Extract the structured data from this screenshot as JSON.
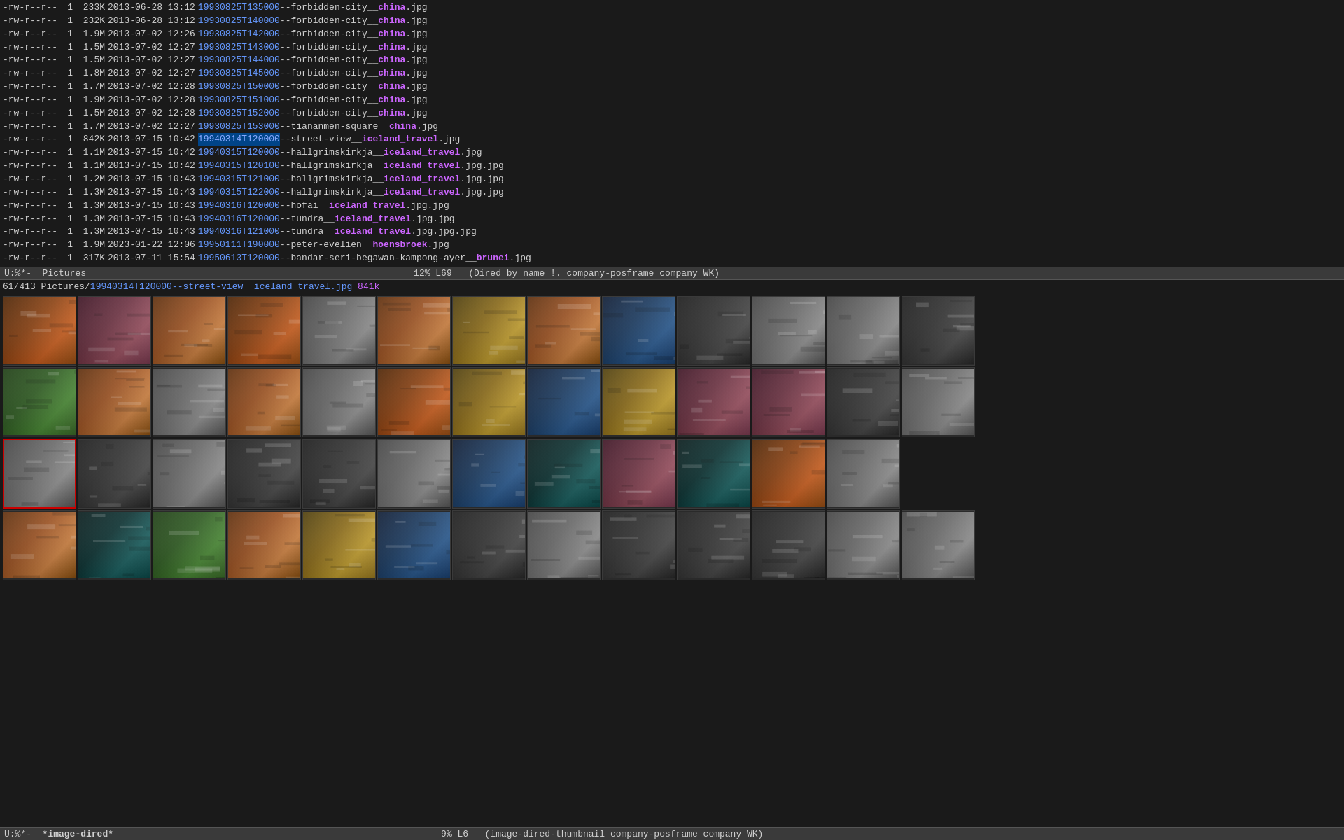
{
  "terminal": {
    "files": [
      {
        "perm": "-rw-r--r--",
        "links": "1",
        "size": "233K",
        "date": "2013-06-28",
        "time": "13:12",
        "link": "19930825T135000",
        "sep": "--",
        "desc": "forbidden-city__",
        "tag": "china",
        "ext": ".jpg",
        "tag_color": "purple"
      },
      {
        "perm": "-rw-r--r--",
        "links": "1",
        "size": "232K",
        "date": "2013-06-28",
        "time": "13:12",
        "link": "19930825T140000",
        "sep": "--",
        "desc": "forbidden-city__",
        "tag": "china",
        "ext": ".jpg",
        "tag_color": "purple"
      },
      {
        "perm": "-rw-r--r--",
        "links": "1",
        "size": "1.9M",
        "date": "2013-07-02",
        "time": "12:26",
        "link": "19930825T142000",
        "sep": "--",
        "desc": "forbidden-city__",
        "tag": "china",
        "ext": ".jpg",
        "tag_color": "purple"
      },
      {
        "perm": "-rw-r--r--",
        "links": "1",
        "size": "1.5M",
        "date": "2013-07-02",
        "time": "12:27",
        "link": "19930825T143000",
        "sep": "--",
        "desc": "forbidden-city__",
        "tag": "china",
        "ext": ".jpg",
        "tag_color": "purple"
      },
      {
        "perm": "-rw-r--r--",
        "links": "1",
        "size": "1.5M",
        "date": "2013-07-02",
        "time": "12:27",
        "link": "19930825T144000",
        "sep": "--",
        "desc": "forbidden-city__",
        "tag": "china",
        "ext": ".jpg",
        "tag_color": "purple"
      },
      {
        "perm": "-rw-r--r--",
        "links": "1",
        "size": "1.8M",
        "date": "2013-07-02",
        "time": "12:27",
        "link": "19930825T145000",
        "sep": "--",
        "desc": "forbidden-city__",
        "tag": "china",
        "ext": ".jpg",
        "tag_color": "purple"
      },
      {
        "perm": "-rw-r--r--",
        "links": "1",
        "size": "1.7M",
        "date": "2013-07-02",
        "time": "12:28",
        "link": "19930825T150000",
        "sep": "--",
        "desc": "forbidden-city__",
        "tag": "china",
        "ext": ".jpg",
        "tag_color": "purple"
      },
      {
        "perm": "-rw-r--r--",
        "links": "1",
        "size": "1.9M",
        "date": "2013-07-02",
        "time": "12:28",
        "link": "19930825T151000",
        "sep": "--",
        "desc": "forbidden-city__",
        "tag": "china",
        "ext": ".jpg",
        "tag_color": "purple"
      },
      {
        "perm": "-rw-r--r--",
        "links": "1",
        "size": "1.5M",
        "date": "2013-07-02",
        "time": "12:28",
        "link": "19930825T152000",
        "sep": "--",
        "desc": "forbidden-city__",
        "tag": "china",
        "ext": ".jpg",
        "tag_color": "purple"
      },
      {
        "perm": "-rw-r--r--",
        "links": "1",
        "size": "1.7M",
        "date": "2013-07-02",
        "time": "12:27",
        "link": "19930825T153000",
        "sep": "--",
        "desc": "tiananmen-square__",
        "tag": "china",
        "ext": ".jpg",
        "tag_color": "purple"
      },
      {
        "perm": "-rw-r--r--",
        "links": "1",
        "size": "842K",
        "date": "2013-07-15",
        "time": "10:42",
        "link": "19940314T120000",
        "sep": "--",
        "desc": "street-view__",
        "tag": "iceland_travel",
        "ext": ".jpg",
        "tag_color": "purple",
        "selected": true
      },
      {
        "perm": "-rw-r--r--",
        "links": "1",
        "size": "1.1M",
        "date": "2013-07-15",
        "time": "10:42",
        "link": "19940315T120000",
        "sep": "--",
        "desc": "hallgrimskirkja__",
        "tag": "iceland_travel",
        "ext": ".jpg",
        "tag_color": "purple"
      },
      {
        "perm": "-rw-r--r--",
        "links": "1",
        "size": "1.1M",
        "date": "2013-07-15",
        "time": "10:42",
        "link": "19940315T120100",
        "sep": "--",
        "desc": "hallgrimskirkja__",
        "tag": "iceland_travel",
        "ext": ".jpg.jpg",
        "tag_color": "purple"
      },
      {
        "perm": "-rw-r--r--",
        "links": "1",
        "size": "1.2M",
        "date": "2013-07-15",
        "time": "10:43",
        "link": "19940315T121000",
        "sep": "--",
        "desc": "hallgrimskirkja__",
        "tag": "iceland_travel",
        "ext": ".jpg.jpg",
        "tag_color": "purple"
      },
      {
        "perm": "-rw-r--r--",
        "links": "1",
        "size": "1.3M",
        "date": "2013-07-15",
        "time": "10:43",
        "link": "19940315T122000",
        "sep": "--",
        "desc": "hallgrimskirkja__",
        "tag": "iceland_travel",
        "ext": ".jpg.jpg",
        "tag_color": "purple"
      },
      {
        "perm": "-rw-r--r--",
        "links": "1",
        "size": "1.3M",
        "date": "2013-07-15",
        "time": "10:43",
        "link": "19940316T120000",
        "sep": "--",
        "desc": "hofai__",
        "tag": "iceland_travel",
        "ext": ".jpg.jpg",
        "tag_color": "purple"
      },
      {
        "perm": "-rw-r--r--",
        "links": "1",
        "size": "1.3M",
        "date": "2013-07-15",
        "time": "10:43",
        "link": "19940316T120000",
        "sep": "--",
        "desc": "tundra__",
        "tag": "iceland_travel",
        "ext": ".jpg.jpg",
        "tag_color": "purple"
      },
      {
        "perm": "-rw-r--r--",
        "links": "1",
        "size": "1.3M",
        "date": "2013-07-15",
        "time": "10:43",
        "link": "19940316T121000",
        "sep": "--",
        "desc": "tundra__",
        "tag": "iceland_travel",
        "ext": ".jpg.jpg.jpg",
        "tag_color": "purple"
      },
      {
        "perm": "-rw-r--r--",
        "links": "1",
        "size": "1.9M",
        "date": "2023-01-22",
        "time": "12:06",
        "link": "19950111T190000",
        "sep": "--",
        "desc": "peter-evelien__",
        "tag": "hoensbroek",
        "ext": ".jpg",
        "tag_color": "purple"
      },
      {
        "perm": "-rw-r--r--",
        "links": "1",
        "size": "317K",
        "date": "2013-07-11",
        "time": "15:54",
        "link": "19950613T120000",
        "sep": "--",
        "desc": "bandar-seri-begawan-kampong-ayer__",
        "tag": "brunei",
        "ext": ".jpg",
        "tag_color": "purple"
      }
    ],
    "status_bar_top": {
      "mode": "U:%*-",
      "buffer": "Pictures",
      "percent": "12%",
      "line": "L69",
      "extra": "(Dired by name !. company-posframe company WK)"
    },
    "file_info": {
      "num": "61/413",
      "path": "Pictures/",
      "filename": "19940314T120000--street-view__iceland_travel.jpg",
      "size": "841k"
    },
    "status_bar_bottom": {
      "mode": "U:%*-",
      "buffer": "*image-dired*",
      "percent": "9%",
      "line": "L6",
      "extra": "(image-dired-thumbnail company-posframe company WK)"
    }
  },
  "thumbnails": {
    "rows": [
      {
        "cells": [
          {
            "color": "t-orangish",
            "selected": false,
            "id": "r1c1"
          },
          {
            "color": "t-pinkish",
            "selected": false,
            "id": "r1c2"
          },
          {
            "color": "t-redish",
            "selected": false,
            "id": "r1c3"
          },
          {
            "color": "t-orangish",
            "selected": false,
            "id": "r1c4"
          },
          {
            "color": "t-grayish",
            "selected": false,
            "id": "r1c5"
          },
          {
            "color": "t-redish",
            "selected": false,
            "id": "r1c6"
          },
          {
            "color": "t-yellowish",
            "selected": false,
            "id": "r1c7"
          },
          {
            "color": "t-redish",
            "selected": false,
            "id": "r1c8"
          },
          {
            "color": "t-blueish",
            "selected": false,
            "id": "r1c9"
          },
          {
            "color": "t-darkgray",
            "selected": false,
            "id": "r1c10"
          },
          {
            "color": "t-grayish",
            "selected": false,
            "id": "r1c11"
          },
          {
            "color": "t-grayish",
            "selected": false,
            "id": "r1c12"
          },
          {
            "color": "t-darkgray",
            "selected": false,
            "id": "r1c13"
          }
        ]
      },
      {
        "cells": [
          {
            "color": "t-greenish",
            "selected": false,
            "id": "r2c1"
          },
          {
            "color": "t-redish",
            "selected": false,
            "id": "r2c2"
          },
          {
            "color": "t-grayish",
            "selected": false,
            "id": "r2c3"
          },
          {
            "color": "t-redish",
            "selected": false,
            "id": "r2c4"
          },
          {
            "color": "t-grayish",
            "selected": false,
            "id": "r2c5"
          },
          {
            "color": "t-orangish",
            "selected": false,
            "id": "r2c6"
          },
          {
            "color": "t-yellowish",
            "selected": false,
            "id": "r2c7"
          },
          {
            "color": "t-blueish",
            "selected": false,
            "id": "r2c8"
          },
          {
            "color": "t-yellowish",
            "selected": false,
            "id": "r2c9"
          },
          {
            "color": "t-pinkish",
            "selected": false,
            "id": "r2c10"
          },
          {
            "color": "t-pinkish",
            "selected": false,
            "id": "r2c11"
          },
          {
            "color": "t-darkgray",
            "selected": false,
            "id": "r2c12"
          },
          {
            "color": "t-grayish",
            "selected": false,
            "id": "r2c13"
          }
        ]
      },
      {
        "cells": [
          {
            "color": "t-grayish",
            "selected": true,
            "id": "r3c1"
          },
          {
            "color": "t-darkgray",
            "selected": false,
            "id": "r3c2"
          },
          {
            "color": "t-grayish",
            "selected": false,
            "id": "r3c3"
          },
          {
            "color": "t-darkgray",
            "selected": false,
            "id": "r3c4"
          },
          {
            "color": "t-darkgray",
            "selected": false,
            "id": "r3c5"
          },
          {
            "color": "t-grayish",
            "selected": false,
            "id": "r3c6"
          },
          {
            "color": "t-blueish",
            "selected": false,
            "id": "r3c7"
          },
          {
            "color": "t-teal",
            "selected": false,
            "id": "r3c8"
          },
          {
            "color": "t-pinkish",
            "selected": false,
            "id": "r3c9"
          },
          {
            "color": "t-teal",
            "selected": false,
            "id": "r3c10"
          },
          {
            "color": "t-orangish",
            "selected": false,
            "id": "r3c11"
          },
          {
            "color": "t-grayish",
            "selected": false,
            "id": "r3c12"
          }
        ]
      },
      {
        "cells": [
          {
            "color": "t-redish",
            "selected": false,
            "id": "r4c1"
          },
          {
            "color": "t-teal",
            "selected": false,
            "id": "r4c2"
          },
          {
            "color": "t-greenish",
            "selected": false,
            "id": "r4c3"
          },
          {
            "color": "t-redish",
            "selected": false,
            "id": "r4c4"
          },
          {
            "color": "t-yellowish",
            "selected": false,
            "id": "r4c5"
          },
          {
            "color": "t-blueish",
            "selected": false,
            "id": "r4c6"
          },
          {
            "color": "t-darkgray",
            "selected": false,
            "id": "r4c7"
          },
          {
            "color": "t-grayish",
            "selected": false,
            "id": "r4c8"
          },
          {
            "color": "t-darkgray",
            "selected": false,
            "id": "r4c9"
          },
          {
            "color": "t-darkgray",
            "selected": false,
            "id": "r4c10"
          },
          {
            "color": "t-darkgray",
            "selected": false,
            "id": "r4c11"
          },
          {
            "color": "t-grayish",
            "selected": false,
            "id": "r4c12"
          },
          {
            "color": "t-grayish",
            "selected": false,
            "id": "r4c13"
          }
        ]
      }
    ]
  }
}
